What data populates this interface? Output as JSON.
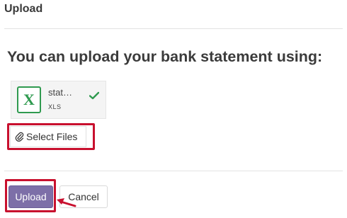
{
  "dialog": {
    "title": "Upload"
  },
  "heading": "You can upload your bank statement using:",
  "file": {
    "name": "stat…",
    "extension": "XLS",
    "icon_letter": "X",
    "icon": "excel-file-icon",
    "status_icon": "check-icon"
  },
  "select_files": {
    "label": "Select Files",
    "icon": "paperclip-icon"
  },
  "footer": {
    "upload_label": "Upload",
    "cancel_label": "Cancel"
  },
  "colors": {
    "primary": "#7d6fa8",
    "highlight": "#c8102e",
    "success": "#2f9a4f"
  }
}
